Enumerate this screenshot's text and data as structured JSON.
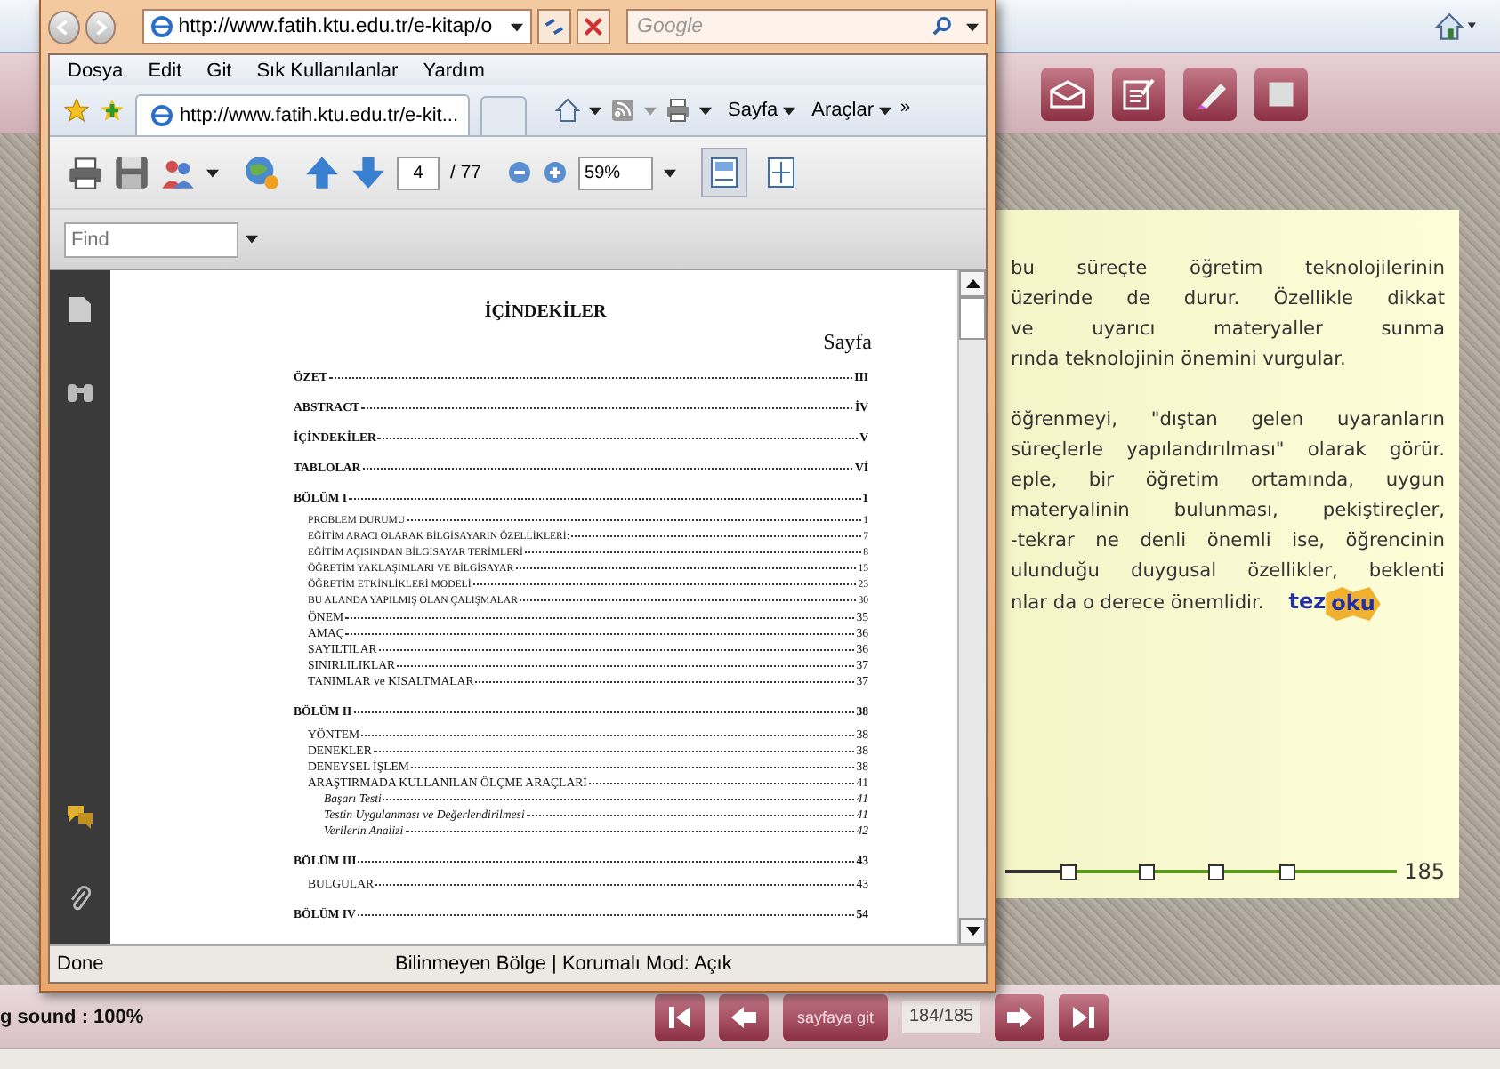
{
  "browser": {
    "address": "http://www.fatih.ktu.edu.tr/e-kitap/o",
    "search_placeholder": "Google",
    "menu": [
      "Dosya",
      "Edit",
      "Git",
      "Sık Kullanılanlar",
      "Yardım"
    ],
    "tabs": [
      {
        "title": "http://www.fatih.ktu.edu.tr/e-kit...",
        "selected": true
      },
      {
        "selected": false
      }
    ],
    "commands": [
      "Sayfa",
      "Araçlar"
    ],
    "more": "»"
  },
  "pdf": {
    "page": "4",
    "total": "/ 77",
    "zoom": "59%",
    "find_placeholder": "Find",
    "fit_width_selected": true
  },
  "toc": {
    "title": "İÇİNDEKİLER",
    "page_heading": "Sayfa",
    "entries": [
      {
        "label": "ÖZET",
        "page": "III"
      },
      {
        "label": "ABSTRACT",
        "page": "İV"
      },
      {
        "label": "İÇİNDEKİLER",
        "page": "V"
      },
      {
        "label": "TABLOLAR",
        "page": "Vİ"
      },
      {
        "label": "BÖLÜM I",
        "page": "1",
        "children": [
          {
            "label": "PROBLEM DURUMU",
            "page": "1",
            "kind": "smallcaps"
          },
          {
            "label": "EĞİTİM ARACI OLARAK BİLGİSAYARIN ÖZELLİKLERİ:",
            "page": "7",
            "kind": "smallcaps"
          },
          {
            "label": "EĞİTİM AÇISINDAN BİLGİSAYAR TERİMLERİ",
            "page": "8",
            "kind": "smallcaps"
          },
          {
            "label": "ÖĞRETİM YAKLAŞIMLARI VE BİLGİSAYAR",
            "page": "15",
            "kind": "smallcaps"
          },
          {
            "label": "ÖĞRETİM ETKİNLİKLERİ MODELİ",
            "page": "23",
            "kind": "smallcaps"
          },
          {
            "label": "BU ALANDA YAPILMIŞ OLAN ÇALIŞMALAR",
            "page": "30",
            "kind": "smallcaps"
          },
          {
            "label": "ÖNEM",
            "page": "35",
            "kind": "caps"
          },
          {
            "label": "AMAÇ",
            "page": "36",
            "kind": "caps"
          },
          {
            "label": "SAYILTILAR",
            "page": "36",
            "kind": "caps"
          },
          {
            "label": "SINIRLILIKLAR",
            "page": "37",
            "kind": "caps"
          },
          {
            "label": "TANIMLAR ve KISALTMALAR",
            "page": "37",
            "kind": "caps"
          }
        ]
      },
      {
        "label": "BÖLÜM II",
        "page": "38",
        "children": [
          {
            "label": "YÖNTEM",
            "page": "38",
            "kind": "caps"
          },
          {
            "label": "DENEKLER",
            "page": "38",
            "kind": "caps"
          },
          {
            "label": "DENEYSEL İŞLEM",
            "page": "38",
            "kind": "caps"
          },
          {
            "label": "ARAŞTIRMADA KULLANILAN ÖLÇME ARAÇLARI",
            "page": "41",
            "kind": "caps",
            "children": [
              {
                "label": "Başarı Testi",
                "page": "41",
                "kind": "italic"
              },
              {
                "label": "Testin Uygulanması ve Değerlendirilmesi",
                "page": "41",
                "kind": "italic"
              },
              {
                "label": "Verilerin Analizi",
                "page": "42",
                "kind": "italic"
              }
            ]
          }
        ]
      },
      {
        "label": "BÖLÜM III",
        "page": "43",
        "children": [
          {
            "label": "BULGULAR",
            "page": "43",
            "kind": "caps"
          }
        ]
      },
      {
        "label": "BÖLÜM IV",
        "page": "54"
      }
    ]
  },
  "status": {
    "left": "Done",
    "zone": "Bilinmeyen Bölge | Korumalı Mod: Açık"
  },
  "book": {
    "paragraphs": [
      [
        "bu süreçte öğretim teknolojilerinin",
        "üzerinde de durur. Özellikle dikkat",
        "ve uyarıcı materyaller sunma",
        "rında teknolojinin önemini vurgular."
      ],
      [
        "öğrenmeyi, \"dıştan gelen uyaranların",
        "süreçlerle yapılandırılması\" olarak görür.",
        "eple, bir öğretim ortamında, uygun",
        "materyalinin bulunması, pekiştireçler,",
        "-tekrar ne denli önemli ise, öğrencinin",
        "ulunduğu duygusal özellikler, beklenti",
        "nlar da o derece önemlidir."
      ]
    ],
    "logo": [
      "tez",
      "oku"
    ],
    "page_number": "185",
    "slider": {
      "level": 0.14
    }
  },
  "bottom": {
    "sound": "g sound : 100%",
    "goto": "sayfaya git",
    "page": "184/185"
  }
}
